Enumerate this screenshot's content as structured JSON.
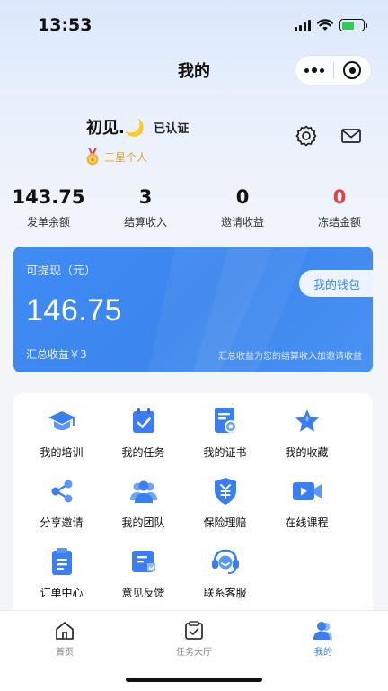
{
  "status_bar": {
    "time": "13:53"
  },
  "nav": {
    "title": "我的"
  },
  "profile": {
    "name": "初见.🌙",
    "verified": "已认证",
    "level": "三星个人"
  },
  "stats": [
    {
      "value": "143.75",
      "label": "发单余额"
    },
    {
      "value": "3",
      "label": "结算收入"
    },
    {
      "value": "0",
      "label": "邀请收益"
    },
    {
      "value": "0",
      "label": "冻结金额"
    }
  ],
  "wallet": {
    "label": "可提现（元）",
    "amount": "146.75",
    "button": "我的钱包",
    "total": "汇总收益￥3",
    "note": "汇总收益为您的结算收入加邀请收益"
  },
  "menu": [
    {
      "label": "我的培训",
      "icon": "graduation-cap-icon"
    },
    {
      "label": "我的任务",
      "icon": "task-check-icon"
    },
    {
      "label": "我的证书",
      "icon": "certificate-icon"
    },
    {
      "label": "我的收藏",
      "icon": "star-icon"
    },
    {
      "label": "分享邀请",
      "icon": "share-icon"
    },
    {
      "label": "我的团队",
      "icon": "team-icon"
    },
    {
      "label": "保险理赔",
      "icon": "insurance-shield-icon"
    },
    {
      "label": "在线课程",
      "icon": "video-camera-icon"
    },
    {
      "label": "订单中心",
      "icon": "order-clipboard-icon"
    },
    {
      "label": "意见反馈",
      "icon": "feedback-icon"
    },
    {
      "label": "联系客服",
      "icon": "headset-icon"
    }
  ],
  "tabbar": [
    {
      "label": "首页",
      "icon": "home-icon"
    },
    {
      "label": "任务大厅",
      "icon": "task-hall-icon"
    },
    {
      "label": "我的",
      "icon": "user-icon"
    }
  ],
  "colors": {
    "accent": "#3c86ee",
    "danger": "#e0444b",
    "gold": "#e0a33a"
  }
}
